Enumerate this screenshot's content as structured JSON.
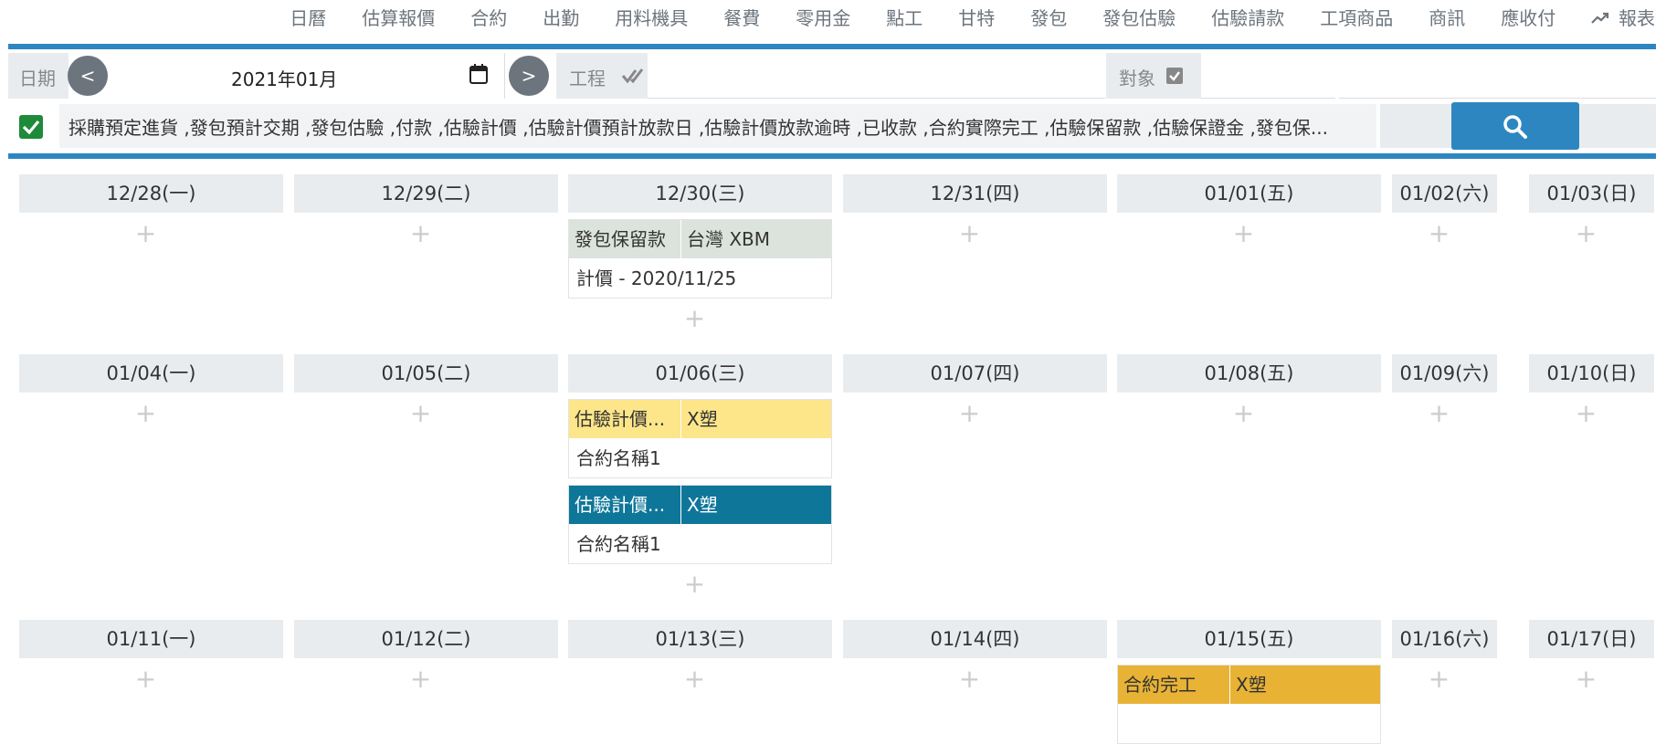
{
  "nav": {
    "items": [
      "日曆",
      "估算報價",
      "合約",
      "出勤",
      "用料機具",
      "餐費",
      "零用金",
      "點工",
      "甘特",
      "發包",
      "發包估驗",
      "估驗請款",
      "工項商品",
      "商訊",
      "應收付"
    ],
    "report": "報表"
  },
  "filter": {
    "date_label": "日期",
    "prev": "<",
    "next": ">",
    "date_value": "2021年01月",
    "project_label": "工程",
    "target_label": "對象",
    "types_value": "採購預定進貨 ,發包預計交期 ,發包估驗 ,付款 ,估驗計價 ,估驗計價預計放款日 ,估驗計價放款逾時 ,已收款 ,合約實際完工 ,估驗保留款 ,估驗保證金 ,發包保..."
  },
  "calendar": {
    "plus": "+",
    "weeks": [
      {
        "days": [
          "12/28(一)",
          "12/29(二)",
          "12/30(三)",
          "12/31(四)",
          "01/01(五)",
          "01/02(六)",
          "01/03(日)"
        ]
      },
      {
        "days": [
          "01/04(一)",
          "01/05(二)",
          "01/06(三)",
          "01/07(四)",
          "01/08(五)",
          "01/09(六)",
          "01/10(日)"
        ]
      },
      {
        "days": [
          "01/11(一)",
          "01/12(二)",
          "01/13(三)",
          "01/14(四)",
          "01/15(五)",
          "01/16(六)",
          "01/17(日)"
        ]
      }
    ],
    "events": [
      {
        "type": "發包保留款",
        "target": "台灣 XBM",
        "body": "計價 - 2020/11/25",
        "color": "#dbe3dc",
        "text_color": "#333"
      },
      {
        "type": "估驗計價...",
        "target": "X塑",
        "body": "合約名稱1",
        "color": "#fde68a",
        "text_color": "#333"
      },
      {
        "type": "估驗計價...",
        "target": "X塑",
        "body": "合約名稱1",
        "color": "#0e7699",
        "text_color": "#ffffff"
      },
      {
        "type": "合約完工",
        "target": "X塑",
        "body": "",
        "color": "#e8b235",
        "text_color": "#333"
      }
    ]
  },
  "colors": {
    "accent": "#2e86c1",
    "check_green": "#1e8a3a",
    "header_gray": "#e9ecef"
  }
}
